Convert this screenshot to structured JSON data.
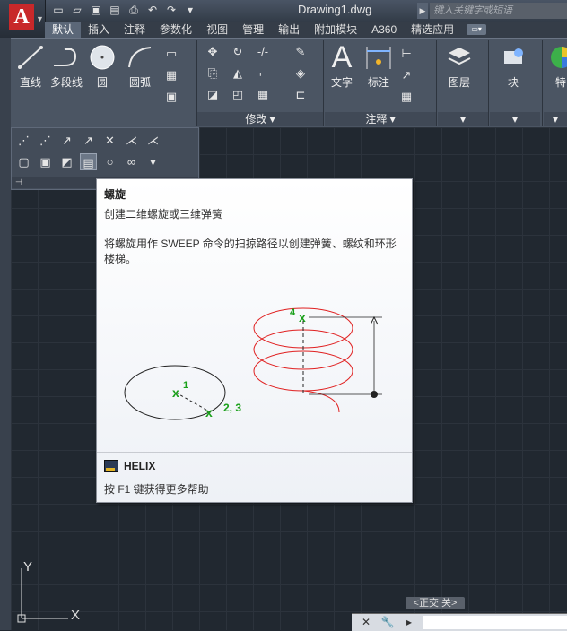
{
  "titlebar": {
    "app_logo": "A",
    "document_title": "Drawing1.dwg",
    "search_placeholder": "键入关键字或短语",
    "qat_icons": [
      "new-icon",
      "open-icon",
      "save-icon",
      "saveas-icon",
      "print-icon",
      "undo-icon",
      "redo-icon",
      "dropdown-icon"
    ]
  },
  "tabs": [
    {
      "label": "默认",
      "active": true
    },
    {
      "label": "插入"
    },
    {
      "label": "注释"
    },
    {
      "label": "参数化"
    },
    {
      "label": "视图"
    },
    {
      "label": "管理"
    },
    {
      "label": "输出"
    },
    {
      "label": "附加模块"
    },
    {
      "label": "A360"
    },
    {
      "label": "精选应用"
    }
  ],
  "ribbon": {
    "draw": {
      "line": "直线",
      "polyline": "多段线",
      "circle": "圆",
      "arc": "圆弧"
    },
    "modify_label": "修改",
    "annotation": {
      "text": "文字",
      "dimension": "标注",
      "panel_label": "注释"
    },
    "layers": "图层",
    "block": "块",
    "props": "特"
  },
  "tooltip": {
    "title": "螺旋",
    "description": "创建二维螺旋或三维弹簧",
    "long_description": "将螺旋用作 SWEEP 命令的扫掠路径以创建弹簧、螺纹和环形楼梯。",
    "labels": {
      "p1": "1",
      "p23": "2, 3",
      "p4": "4"
    },
    "command": "HELIX",
    "help": "按 F1 键获得更多帮助"
  },
  "ucs": {
    "x": "X",
    "y": "Y"
  },
  "status": {
    "ortho": "<正交 关>"
  },
  "colors": {
    "accent": "#c8282a",
    "helix": "#e02020",
    "marker": "#1aa01a"
  }
}
